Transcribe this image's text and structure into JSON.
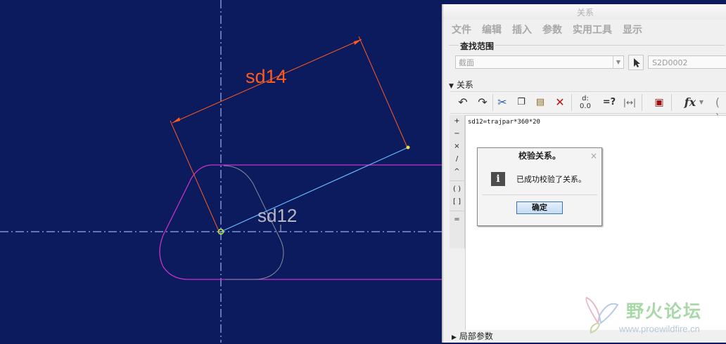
{
  "cad": {
    "dimension_1": "sd14",
    "dimension_2": "sd12",
    "colors": {
      "background": "#0b1b5e",
      "dimension_orange": "#ff5a1e",
      "profile_magenta": "#c832c8",
      "center_line": "#b8d0ff",
      "sketch_line": "#6ab8ff"
    }
  },
  "relations_panel": {
    "title": "关系",
    "menu": [
      "文件",
      "编辑",
      "插入",
      "参数",
      "实用工具",
      "显示"
    ],
    "search_scope_label": "查找范围",
    "scope_select_value": "截面",
    "scope_field_value": "S2D0002",
    "relations_section_label": "关系",
    "toolbar_icons": [
      "undo-icon",
      "redo-icon",
      "cut-icon",
      "copy-icon",
      "paste-icon",
      "delete-icon",
      "evaluate-icon",
      "verify-icon",
      "dimension-icon",
      "units-icon",
      "function-icon"
    ],
    "side_operators": [
      "+",
      "−",
      "×",
      "/",
      "^",
      "( )",
      "[ ]",
      "="
    ],
    "relation_text": "sd12=trajpar*360*20",
    "local_params_label": "局部参数"
  },
  "verify_dialog": {
    "title": "校验关系。",
    "close": "×",
    "message": "已成功校验了关系。",
    "ok_label": "确定",
    "info_icon_glyph": "i"
  },
  "watermark": {
    "text": "野火论坛",
    "url": "www.proewildfire.cn"
  }
}
